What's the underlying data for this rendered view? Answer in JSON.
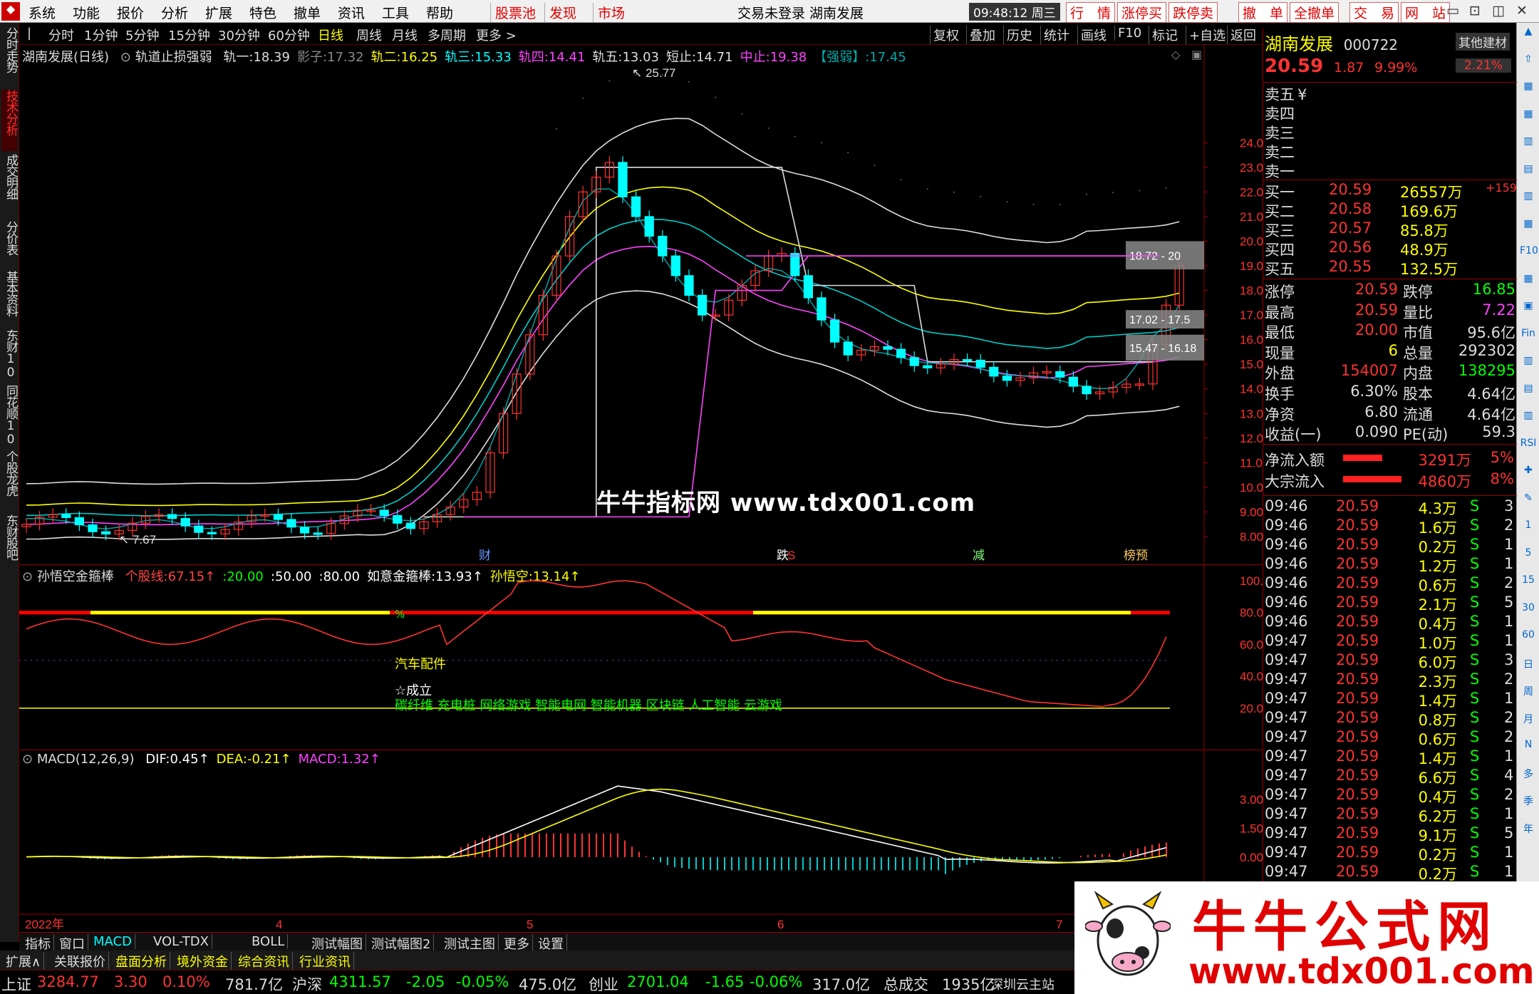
{
  "menu": {
    "items": [
      "系统",
      "功能",
      "报价",
      "分析",
      "扩展",
      "特色",
      "撤单",
      "资讯",
      "工具",
      "帮助"
    ],
    "red_buttons": [
      "股票池",
      "发现",
      "市场"
    ],
    "status_center": "交易未登录  湖南发展",
    "clock": "09:48:12 周三",
    "right_buttons": [
      "行　情",
      "涨停买",
      "跌停卖",
      "撤　单",
      "全撤单",
      "交　易",
      "网　站"
    ]
  },
  "toolbar": {
    "periods": [
      "分时",
      "1分钟",
      "5分钟",
      "15分钟",
      "30分钟",
      "60分钟",
      "日线",
      "周线",
      "月线",
      "多周期",
      "更多 >"
    ],
    "active_period": "日线",
    "actions": [
      "复权",
      "叠加",
      "历史",
      "统计",
      "画线",
      "F10",
      "标记",
      "+自选",
      "返回"
    ]
  },
  "left_tabs": [
    "分时走势",
    "技术分析",
    "成交明细",
    "分价表",
    "基本资料",
    "东财10",
    "同花顺10",
    "个股龙虎",
    "东财股吧"
  ],
  "right_icons": [
    "▲",
    "⇧",
    "▦",
    "▦",
    "▥",
    "▤",
    "▥",
    "▦",
    "F10",
    "▦",
    "▣",
    "Fin",
    "▥",
    "▤",
    "▥",
    "RSI",
    "✚",
    "✎",
    "1",
    "5",
    "15",
    "30",
    "60",
    "日",
    "周",
    "月",
    "N",
    "多",
    "季",
    "年"
  ],
  "main_chart": {
    "title": "湖南发展(日线)",
    "indicator": "轨道止损强弱",
    "fields": [
      {
        "label": "轨一:",
        "value": "18.39",
        "color": "#dddddd"
      },
      {
        "label": "影子:",
        "value": "17.32",
        "color": "#888888"
      },
      {
        "label": "轨二:",
        "value": "16.25",
        "color": "#ffff00"
      },
      {
        "label": "轨三:",
        "value": "15.33",
        "color": "#00ffff"
      },
      {
        "label": "轨四:",
        "value": "14.41",
        "color": "#ff44ff"
      },
      {
        "label": "轨五:",
        "value": "13.03",
        "color": "#dddddd"
      },
      {
        "label": "短止:",
        "value": "14.71",
        "color": "#dddddd"
      },
      {
        "label": "中止:",
        "value": "19.38",
        "color": "#ff44ff"
      },
      {
        "label": "【强弱】:",
        "value": "17.45",
        "color": "#00aaaa"
      }
    ],
    "y_ticks": [
      "24.00",
      "23.00",
      "22.00",
      "21.00",
      "20.00",
      "19.00",
      "18.00",
      "17.00",
      "16.00",
      "15.00",
      "14.00",
      "13.00",
      "12.00",
      "11.00",
      "10.00",
      "9.00",
      "8.00"
    ],
    "high_label": "25.77",
    "low_label": "7.67",
    "price_boxes": [
      "18.72 - 20",
      "17.02 - 17.5",
      "15.47 - 16.18"
    ],
    "event_marks": [
      {
        "text": "财",
        "color": "#6699ff"
      },
      {
        "text": "跌",
        "color": "#ffffff"
      },
      {
        "text": "S",
        "color": "#ff3333"
      },
      {
        "text": "减",
        "color": "#88ff88"
      },
      {
        "text": "榜预",
        "color": "#ffcc66"
      }
    ],
    "watermark": "牛牛指标网 www.tdx001.com"
  },
  "sub1": {
    "title": "孙悟空金箍棒",
    "fields": [
      {
        "label": "个股线:",
        "value": "67.15↑",
        "color": "#ff4444"
      },
      {
        "label": ":",
        "value": "20.00",
        "color": "#00ff00"
      },
      {
        "label": ":",
        "value": "50.00",
        "color": "#ffffff"
      },
      {
        "label": ":",
        "value": "80.00",
        "color": "#ffffff"
      },
      {
        "label": "如意金箍棒:",
        "value": "13.93↑",
        "color": "#ffffff"
      },
      {
        "label": "孙悟空:",
        "value": "13.14↑",
        "color": "#ffff00"
      }
    ],
    "y_ticks": [
      "100.0",
      "80.00",
      "60.00",
      "40.00",
      "20.00"
    ],
    "annotations": {
      "sector": "汽车配件",
      "established": "☆成立",
      "concepts": "碳纤维 充电桩 网络游戏 智能电网 智能机器 区块链 人工智能 云游戏",
      "pct": "%"
    }
  },
  "sub2": {
    "title": "MACD(12,26,9)",
    "fields": [
      {
        "label": "DIF:",
        "value": "0.45↑",
        "color": "#ffffff"
      },
      {
        "label": "DEA:",
        "value": "-0.21↑",
        "color": "#ffff00"
      },
      {
        "label": "MACD:",
        "value": "1.32↑",
        "color": "#ff44ff"
      }
    ],
    "y_ticks": [
      "3.00",
      "1.50",
      "0.00"
    ],
    "x_labels": [
      "2022年",
      "4",
      "5",
      "6",
      "7"
    ]
  },
  "bottom_tabs": [
    "指标",
    "窗口",
    "MACD",
    "VOL-TDX",
    "BOLL",
    "测试幅图",
    "测试幅图2",
    "测试主图",
    "更多",
    "设置"
  ],
  "bottom2_tabs": [
    "扩展∧",
    "关联报价",
    "盘面分析",
    "境外资金",
    "综合资讯",
    "行业资讯"
  ],
  "quote": {
    "name": "湖南发展",
    "code": "000722",
    "sector": "其他建材",
    "price": "20.59",
    "change": "1.87",
    "pct": "9.99%",
    "sector_pct": "2.21%",
    "asks": [
      {
        "label": "卖五",
        "mark": "¥"
      },
      {
        "label": "卖四"
      },
      {
        "label": "卖三"
      },
      {
        "label": "卖二"
      },
      {
        "label": "卖一"
      }
    ],
    "bids": [
      {
        "label": "买一",
        "price": "20.59",
        "vol": "26557万",
        "extra": "+159"
      },
      {
        "label": "买二",
        "price": "20.58",
        "vol": "169.6万"
      },
      {
        "label": "买三",
        "price": "20.57",
        "vol": "85.8万"
      },
      {
        "label": "买四",
        "price": "20.56",
        "vol": "48.9万"
      },
      {
        "label": "买五",
        "price": "20.55",
        "vol": "132.5万"
      }
    ],
    "stats": [
      [
        "涨停",
        "20.59",
        "跌停",
        "16.85"
      ],
      [
        "最高",
        "20.59",
        "量比",
        "7.22"
      ],
      [
        "最低",
        "20.00",
        "市值",
        "95.6亿"
      ],
      [
        "现量",
        "6",
        "总量",
        "292302"
      ],
      [
        "外盘",
        "154007",
        "内盘",
        "138295"
      ],
      [
        "换手",
        "6.30%",
        "股本",
        "4.64亿"
      ],
      [
        "净资",
        "6.80",
        "流通",
        "4.64亿"
      ],
      [
        "收益(一)",
        "0.090",
        "PE(动)",
        "59.3"
      ]
    ],
    "flows": [
      {
        "label": "净流入额",
        "value": "3291万",
        "pct": "5%"
      },
      {
        "label": "大宗流入",
        "value": "4860万",
        "pct": "8%"
      }
    ],
    "ticks": [
      [
        "09:46",
        "20.59",
        "4.3万",
        "S",
        "3"
      ],
      [
        "09:46",
        "20.59",
        "1.6万",
        "S",
        "2"
      ],
      [
        "09:46",
        "20.59",
        "0.2万",
        "S",
        "1"
      ],
      [
        "09:46",
        "20.59",
        "1.2万",
        "S",
        "1"
      ],
      [
        "09:46",
        "20.59",
        "0.6万",
        "S",
        "2"
      ],
      [
        "09:46",
        "20.59",
        "2.1万",
        "S",
        "5"
      ],
      [
        "09:46",
        "20.59",
        "0.4万",
        "S",
        "1"
      ],
      [
        "09:47",
        "20.59",
        "1.0万",
        "S",
        "1"
      ],
      [
        "09:47",
        "20.59",
        "6.0万",
        "S",
        "3"
      ],
      [
        "09:47",
        "20.59",
        "2.3万",
        "S",
        "2"
      ],
      [
        "09:47",
        "20.59",
        "1.4万",
        "S",
        "1"
      ],
      [
        "09:47",
        "20.59",
        "0.8万",
        "S",
        "2"
      ],
      [
        "09:47",
        "20.59",
        "0.6万",
        "S",
        "2"
      ],
      [
        "09:47",
        "20.59",
        "1.4万",
        "S",
        "1"
      ],
      [
        "09:47",
        "20.59",
        "6.6万",
        "S",
        "4"
      ],
      [
        "09:47",
        "20.59",
        "0.4万",
        "S",
        "2"
      ],
      [
        "09:47",
        "20.59",
        "6.2万",
        "S",
        "1"
      ],
      [
        "09:47",
        "20.59",
        "9.1万",
        "S",
        "5"
      ],
      [
        "09:47",
        "20.59",
        "0.2万",
        "S",
        "1"
      ],
      [
        "09:47",
        "20.59",
        "0.2万",
        "S",
        "1"
      ]
    ]
  },
  "status": {
    "indices": [
      {
        "name": "上证",
        "value": "3284.77",
        "chg": "3.30",
        "pct": "0.10%",
        "amt": "781.7亿"
      },
      {
        "name": "沪深",
        "value": "4311.57",
        "chg": "-2.05",
        "pct": "-0.05%",
        "amt": "475.0亿"
      },
      {
        "name": "创业",
        "value": "2701.04",
        "chg": "-1.65",
        "pct": "-0.06%",
        "amt": "317.0亿"
      }
    ],
    "total_label": "总成交",
    "total": "1935亿",
    "site": "深圳云主站"
  },
  "promo": {
    "title": "牛牛公式网",
    "url": "www.tdx001.com"
  },
  "colors": {
    "up": "#ff3232",
    "down": "#00ffff",
    "panel_border": "#990000",
    "accent_yellow": "#ffff00",
    "magenta": "#ff44ff"
  }
}
